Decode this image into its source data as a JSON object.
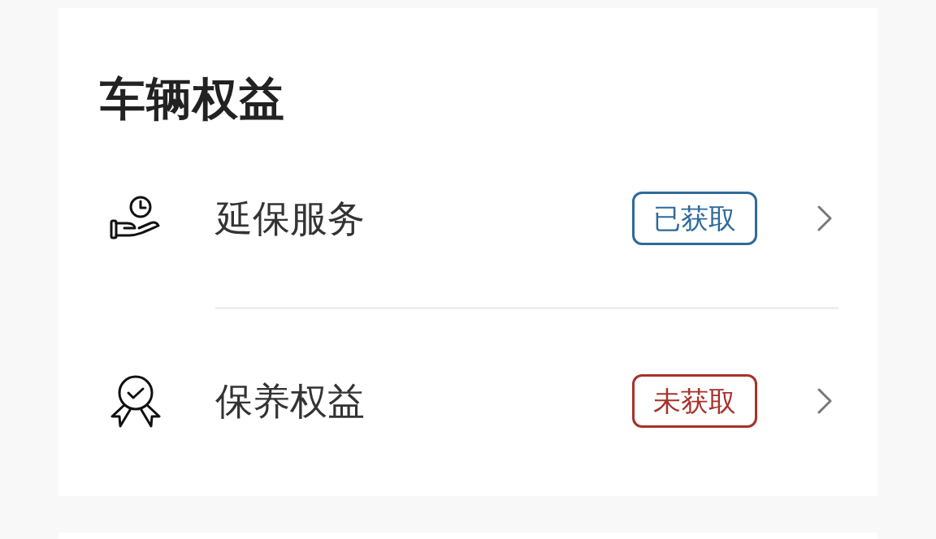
{
  "section": {
    "title": "车辆权益"
  },
  "items": [
    {
      "kind": "warranty",
      "label": "延保服务",
      "badge": "已获取",
      "obtained": true
    },
    {
      "kind": "maintenance",
      "label": "保养权益",
      "badge": "未获取",
      "obtained": false
    }
  ]
}
